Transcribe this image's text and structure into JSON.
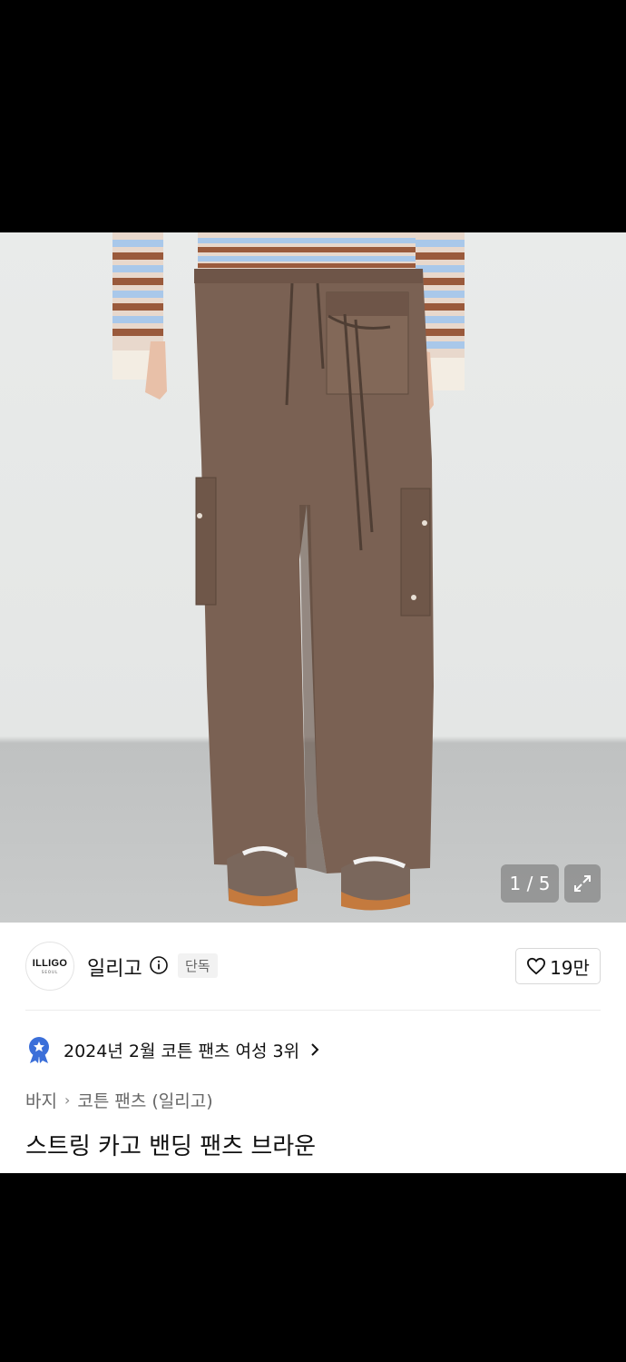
{
  "gallery": {
    "counter": "1 / 5",
    "expand_icon": "expand-icon"
  },
  "brand": {
    "logo_text": "ILLIGO",
    "logo_subtext": "SEOUL",
    "name": "일리고",
    "info_icon": "info-circle-icon",
    "badge": "단독",
    "like_icon": "heart-icon",
    "like_count": "19만"
  },
  "ranking": {
    "icon": "ranking-badge-icon",
    "text": "2024년 2월 코튼 팬츠 여성 3위",
    "chevron": "chevron-right-icon"
  },
  "breadcrumb": {
    "category": "바지",
    "subcategory": "코튼 팬츠",
    "brand": "(일리고)"
  },
  "product": {
    "title": "스트링 카고 밴딩 팬츠 브라운"
  },
  "colors": {
    "pants_brown": "#7a6153",
    "badge_blue": "#3b6fd9",
    "text_primary": "#111111",
    "text_secondary": "#666666"
  }
}
